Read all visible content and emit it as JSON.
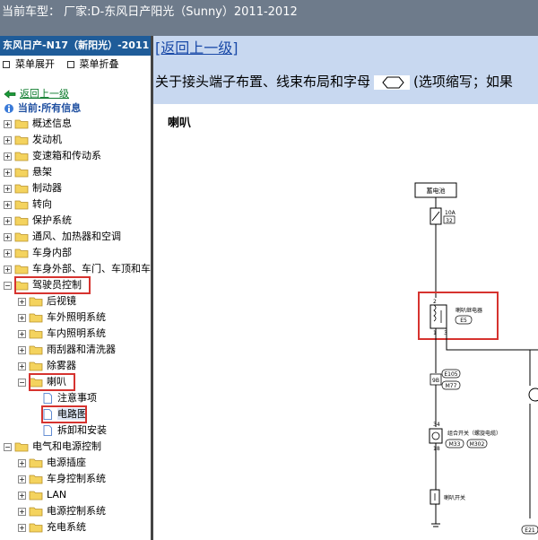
{
  "window": {
    "title": "当前车型：  厂家:D-东风日产阳光（Sunny）2011-2012"
  },
  "sidebar": {
    "header": "东风日产-N17（新阳光）-2011",
    "expand_all": "菜单展开",
    "collapse_all": "菜单折叠",
    "back_label": "返回上一级",
    "current_label": "当前:所有信息",
    "tree": [
      {
        "label": "概述信息",
        "level": 0,
        "type": "folder",
        "state": "+"
      },
      {
        "label": "发动机",
        "level": 0,
        "type": "folder",
        "state": "+"
      },
      {
        "label": "变速箱和传动系",
        "level": 0,
        "type": "folder",
        "state": "+"
      },
      {
        "label": "悬架",
        "level": 0,
        "type": "folder",
        "state": "+"
      },
      {
        "label": "制动器",
        "level": 0,
        "type": "folder",
        "state": "+"
      },
      {
        "label": "转向",
        "level": 0,
        "type": "folder",
        "state": "+"
      },
      {
        "label": "保护系统",
        "level": 0,
        "type": "folder",
        "state": "+"
      },
      {
        "label": "通风、加热器和空调",
        "level": 0,
        "type": "folder",
        "state": "+"
      },
      {
        "label": "车身内部",
        "level": 0,
        "type": "folder",
        "state": "+"
      },
      {
        "label": "车身外部、车门、车顶和车",
        "level": 0,
        "type": "folder",
        "state": "+"
      },
      {
        "label": "驾驶员控制",
        "level": 0,
        "type": "folder",
        "state": "-",
        "highlight": true
      },
      {
        "label": "后视镜",
        "level": 1,
        "type": "folder",
        "state": "+"
      },
      {
        "label": "车外照明系统",
        "level": 1,
        "type": "folder",
        "state": "+"
      },
      {
        "label": "车内照明系统",
        "level": 1,
        "type": "folder",
        "state": "+"
      },
      {
        "label": "雨刮器和清洗器",
        "level": 1,
        "type": "folder",
        "state": "+"
      },
      {
        "label": "除雾器",
        "level": 1,
        "type": "folder",
        "state": "+"
      },
      {
        "label": "喇叭",
        "level": 1,
        "type": "folder",
        "state": "-",
        "highlight": true
      },
      {
        "label": "注意事项",
        "level": 2,
        "type": "doc"
      },
      {
        "label": "电路图",
        "level": 2,
        "type": "doc",
        "highlight": true,
        "selected": true
      },
      {
        "label": "拆卸和安装",
        "level": 2,
        "type": "doc"
      },
      {
        "label": "电气和电源控制",
        "level": 0,
        "type": "folder",
        "state": "-"
      },
      {
        "label": "电源插座",
        "level": 1,
        "type": "folder",
        "state": "+"
      },
      {
        "label": "车身控制系统",
        "level": 1,
        "type": "folder",
        "state": "+"
      },
      {
        "label": "LAN",
        "level": 1,
        "type": "folder",
        "state": "+"
      },
      {
        "label": "电源控制系统",
        "level": 1,
        "type": "folder",
        "state": "+"
      },
      {
        "label": "充电系统",
        "level": 1,
        "type": "folder",
        "state": "+"
      }
    ]
  },
  "content": {
    "back_link": "[返回上一级]",
    "description": "关于接头端子布置、线束布局和字母",
    "description_tail": "(选项缩写；如果",
    "section_title": "喇叭",
    "diagram": {
      "battery": "蓄电池",
      "fuse_rating": "10A",
      "fuse_number": "32",
      "relay_name": "喇叭继电器",
      "relay_conn": "E5",
      "pin_2": "2",
      "pin_1": "1",
      "pin_3": "3",
      "conn_e105": "E105",
      "pin_9b": "9B",
      "conn_m77": "M77",
      "combo_switch": "组合开关（螺旋电缆）",
      "pin_34": "34",
      "pin_18": "18",
      "conn_m33": "M33",
      "conn_m302": "M302",
      "horn_switch": "喇叭开关",
      "conn_e21": "E21"
    }
  },
  "colors": {
    "topbar": "#6e7b8b",
    "sidebar_header": "#1f5c99",
    "banner": "#c8d8f0",
    "highlight": "#d6332f"
  }
}
